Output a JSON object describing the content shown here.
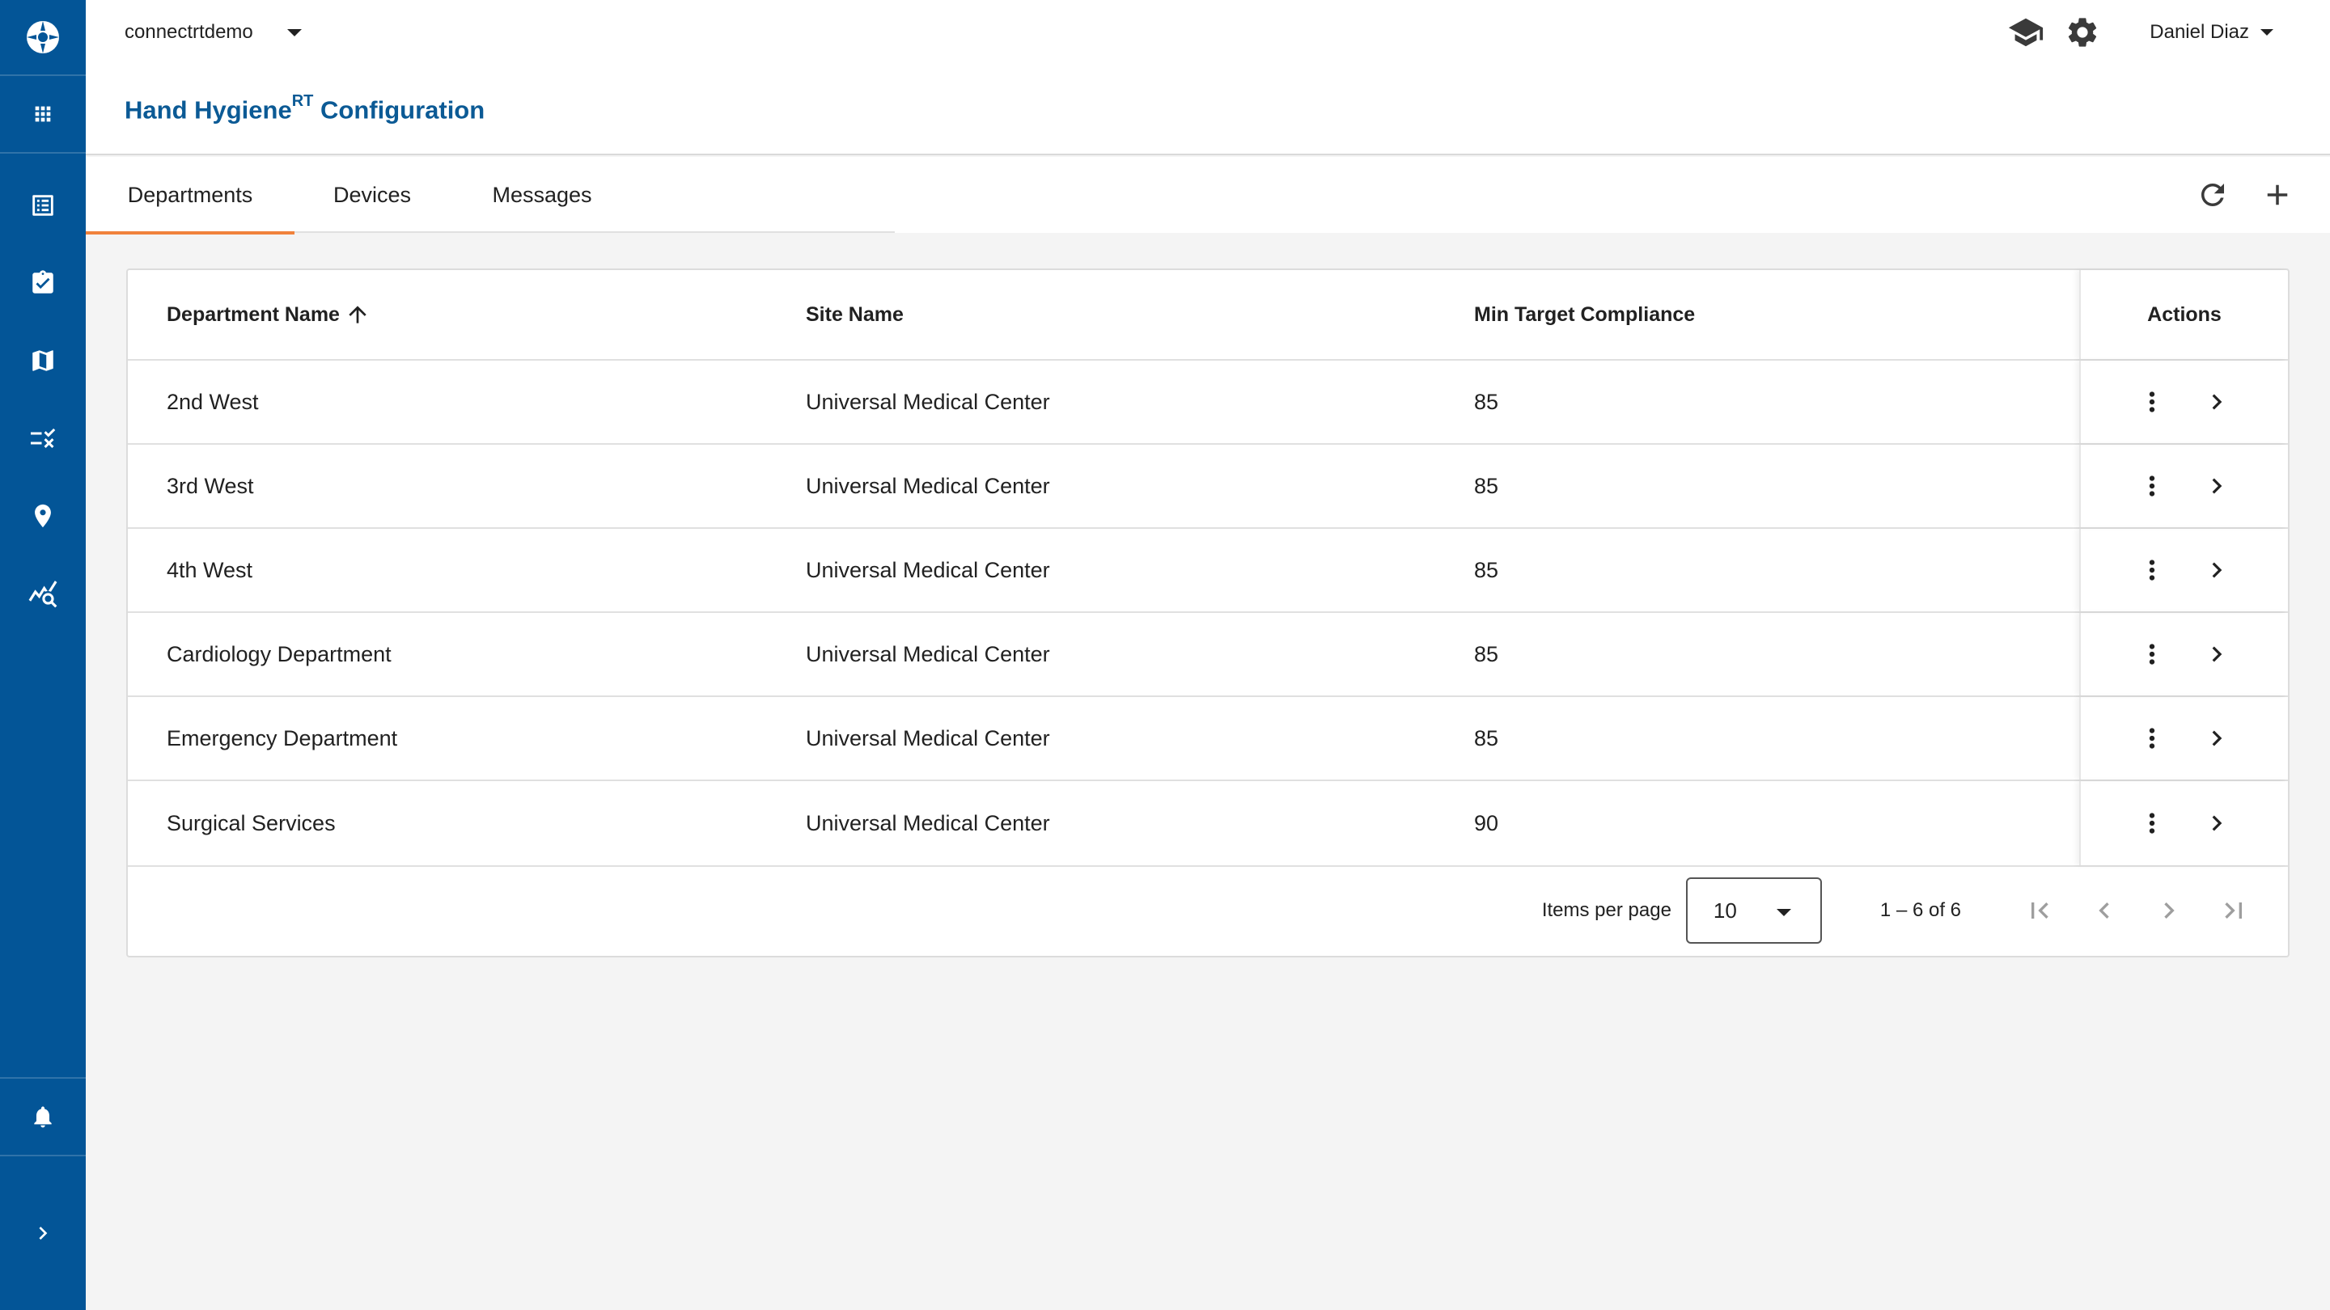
{
  "app": {
    "tenant": "connectrtdemo",
    "user": "Daniel Diaz",
    "title_main": "Hand Hygiene",
    "title_sup": "RT",
    "title_suffix": " Configuration"
  },
  "sidebar": {
    "items": [
      "apps-icon",
      "list-icon",
      "assignment-check-icon",
      "map-icon",
      "rule-icon",
      "location-pin-icon",
      "analytics-search-icon"
    ],
    "bottom": [
      "bell-icon",
      "chevron-right-icon"
    ]
  },
  "tabs": [
    {
      "label": "Departments",
      "active": true
    },
    {
      "label": "Devices",
      "active": false
    },
    {
      "label": "Messages",
      "active": false
    }
  ],
  "table": {
    "headers": {
      "department": "Department Name",
      "site": "Site Name",
      "compliance": "Min Target Compliance",
      "actions": "Actions"
    },
    "rows": [
      {
        "department": "2nd West",
        "site": "Universal Medical Center",
        "compliance": "85"
      },
      {
        "department": "3rd West",
        "site": "Universal Medical Center",
        "compliance": "85"
      },
      {
        "department": "4th West",
        "site": "Universal Medical Center",
        "compliance": "85"
      },
      {
        "department": "Cardiology Department",
        "site": "Universal Medical Center",
        "compliance": "85"
      },
      {
        "department": "Emergency Department",
        "site": "Universal Medical Center",
        "compliance": "85"
      },
      {
        "department": "Surgical Services",
        "site": "Universal Medical Center",
        "compliance": "90"
      }
    ]
  },
  "paginator": {
    "items_per_page_label": "Items per page",
    "items_per_page_value": "10",
    "range": "1 – 6 of 6"
  },
  "colors": {
    "sidebar": "#035597",
    "title": "#0b5a95",
    "tab_indicator": "#f0823c"
  }
}
